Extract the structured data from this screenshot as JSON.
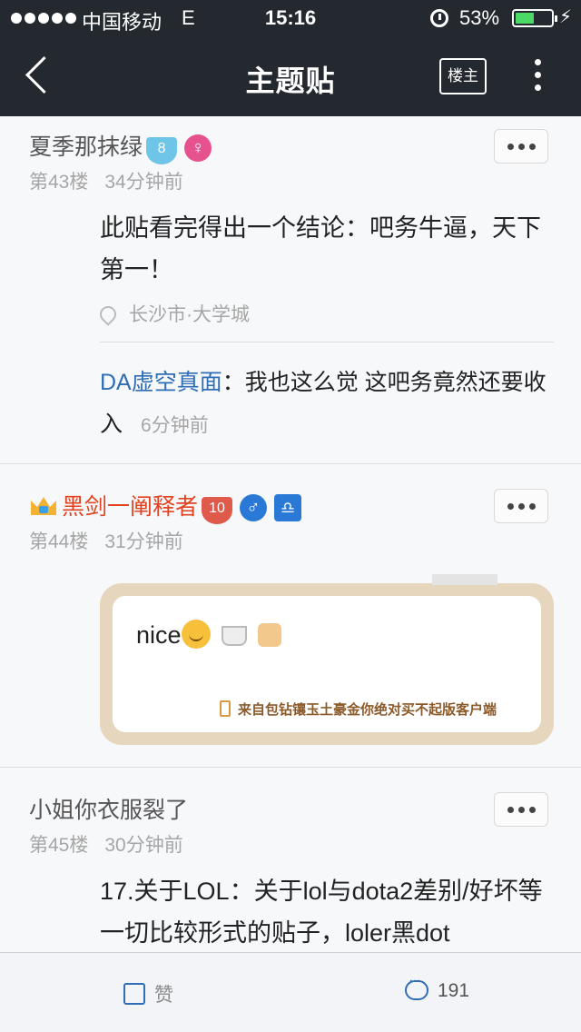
{
  "status_bar": {
    "carrier": "中国移动",
    "network": "E",
    "time": "15:16",
    "battery_percent": "53%",
    "battery_level": 0.53
  },
  "nav": {
    "title": "主题贴",
    "louzhu_label": "楼主"
  },
  "posts": [
    {
      "username": "夏季那抹绿",
      "level": "8",
      "gender": "♀",
      "floor": "第43楼",
      "time": "34分钟前",
      "content": "此贴看完得出一个结论：吧务牛逼，天下第一！",
      "location": "长沙市·大学城",
      "reply": {
        "user": "DA虚空真面",
        "text": "：我也这么觉 这吧务竟然还要收入",
        "time": "6分钟前"
      }
    },
    {
      "username": "黑剑一阐释者",
      "level": "10",
      "gender": "♂",
      "zodiac": "♎",
      "floor": "第44楼",
      "time": "31分钟前",
      "content": "nice",
      "client_tail": "来自包钻镶玉土豪金你绝对买不起版客户端"
    },
    {
      "username": "小姐你衣服裂了",
      "floor": "第45楼",
      "time": "30分钟前",
      "content": "17.关于LOL：关于lol与dota2差别/好坏等一切比较形式的贴子，loler黑dot"
    }
  ],
  "bottom_bar": {
    "like_label": "赞",
    "comment_count": "191"
  },
  "colors": {
    "nav_bg": "#24282f",
    "link_blue": "#2f6db5",
    "vip_red": "#e2421f",
    "card_border": "#e6d6bd"
  }
}
